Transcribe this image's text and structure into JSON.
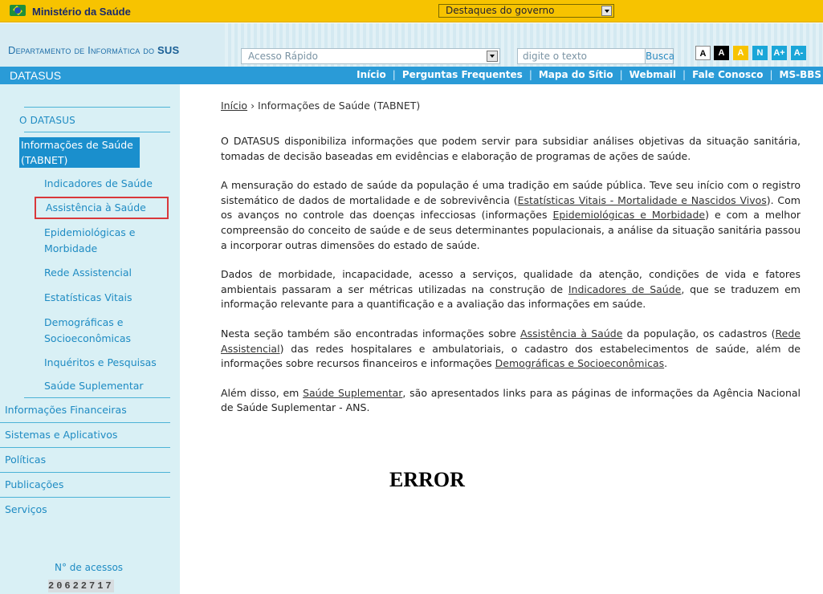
{
  "gov_bar": {
    "ministry": "Ministério da Saúde",
    "highlights_select": "Destaques do governo"
  },
  "dept_bar": {
    "dept_prefix": "Departamento de Informática do",
    "dept_suffix": "SUS",
    "quick_access": "Acesso Rápido",
    "search_placeholder": "digite o texto",
    "search_button": "Busca",
    "accessibility": [
      "A",
      "A",
      "A",
      "N",
      "A+",
      "A-"
    ]
  },
  "nav": {
    "brand": "DATASUS",
    "links": [
      "Início",
      "Perguntas Frequentes",
      "Mapa do Sítio",
      "Webmail",
      "Fale Conosco",
      "MS-BBS"
    ]
  },
  "sidebar": {
    "section": "O DATASUS",
    "active": "Informações de Saúde (TABNET)",
    "subitems": [
      "Indicadores de Saúde",
      "Assistência à Saúde",
      "Epidemiológicas e Morbidade",
      "Rede Assistencial",
      "Estatísticas Vitais",
      "Demográficas e Socioeconômicas",
      "Inquéritos e Pesquisas",
      "Saúde Suplementar"
    ],
    "main_items": [
      "Informações Financeiras",
      "Sistemas e Aplicativos",
      "Políticas",
      "Publicações",
      "Serviços"
    ],
    "counter_label": "N° de acessos",
    "counter_value": "20622717"
  },
  "main": {
    "breadcrumb_home": "Início",
    "breadcrumb_sep": "›",
    "breadcrumb_current": "Informações de Saúde (TABNET)",
    "p1": "O DATASUS disponibiliza informações que podem servir para subsidiar  análises objetivas da situação sanitária, tomadas de decisão baseadas em evidências e elaboração de programas de ações de saúde.",
    "p2_a": "A mensuração do estado de saúde da população é uma tradição em saúde pública. Teve seu início com o registro sistemático de dados de mortalidade e de sobrevivência (",
    "p2_link1": "Estatísticas Vitais - Mortalidade e Nascidos Vivos",
    "p2_b": "). Com os avanços no controle das doenças infecciosas (informações ",
    "p2_link2": "Epidemiológicas e Morbidade",
    "p2_c": ") e com a melhor compreensão do conceito de saúde e de seus determinantes populacionais, a análise da situação sanitária passou a incorporar outras dimensões do estado de saúde.",
    "p3_a": "Dados de morbidade, incapacidade, acesso a serviços, qualidade da atenção, condições de vida e fatores ambientais passaram a ser métricas utilizadas na construção de ",
    "p3_link": "Indicadores de Saúde",
    "p3_b": ", que se traduzem em informação relevante para a quantificação e a avaliação das informações em saúde.",
    "p4_a": "Nesta seção também são encontradas informações sobre ",
    "p4_link1": "Assistência à Saúde",
    "p4_b": " da população, os cadastros (",
    "p4_link2": "Rede Assistencial",
    "p4_c": ") das redes hospitalares e ambulatoriais, o cadastro dos estabelecimentos de saúde, além de informações sobre  recursos financeiros e informações ",
    "p4_link3": "Demográficas e Socioeconômicas",
    "p4_d": ".",
    "p5_a": "Além disso, em ",
    "p5_link": "Saúde Suplementar",
    "p5_b": ", são apresentados links para as páginas de informações da Agência Nacional de Saúde Suplementar - ANS.",
    "error": "ERROR"
  }
}
